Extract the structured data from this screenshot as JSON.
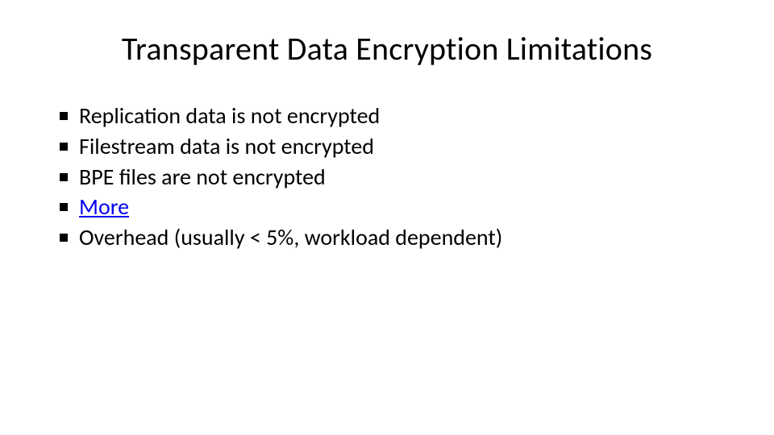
{
  "title": "Transparent Data Encryption Limitations",
  "items": [
    {
      "text": "Replication data is not encrypted",
      "link": false
    },
    {
      "text": "Filestream data is not encrypted",
      "link": false
    },
    {
      "text": "BPE files are not encrypted",
      "link": false
    },
    {
      "text": "More",
      "link": true
    },
    {
      "text": "Overhead (usually < 5%, workload dependent)",
      "link": false
    }
  ]
}
